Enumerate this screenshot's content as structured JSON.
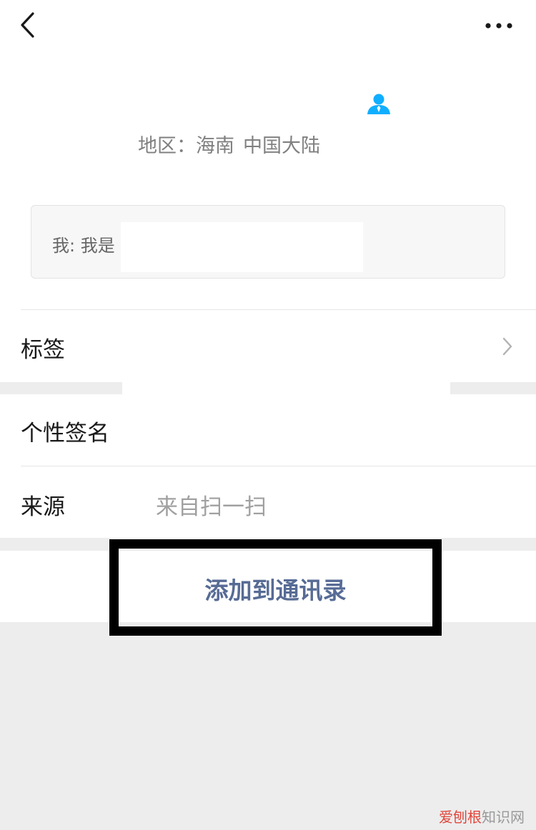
{
  "header": {
    "back_icon": "chevron-left-icon",
    "more_icon": "ellipsis-icon"
  },
  "profile": {
    "contact_icon": "person-icon",
    "contact_icon_color": "#1aad19",
    "region_label": "地区：",
    "region_value_1": "海南",
    "region_value_2": "中国大陆"
  },
  "greeting": {
    "text": "我: 我是"
  },
  "rows": {
    "tags_label": "标签",
    "signature_label": "个性签名",
    "source_label": "来源",
    "source_value": "来自扫一扫"
  },
  "action": {
    "add_contact_label": "添加到通讯录",
    "link_color": "#576b95"
  },
  "watermark": {
    "part1": "爱刨根",
    "part2": "知识网"
  }
}
